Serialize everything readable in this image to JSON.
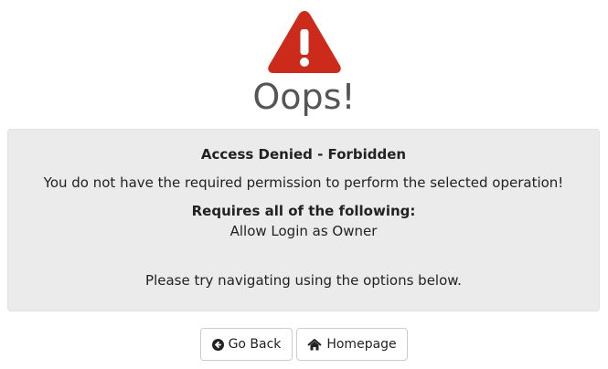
{
  "header": {
    "title": "Oops!",
    "icon": "warning-triangle-icon",
    "accent_color": "#cc2a1a"
  },
  "message": {
    "heading": "Access Denied - Forbidden",
    "body": "You do not have the required permission to perform the selected operation!",
    "requirements_heading": "Requires all of the following:",
    "requirement": "Allow Login as Owner",
    "hint": "Please try navigating using the options below."
  },
  "actions": {
    "back_label": "Go Back",
    "back_icon": "arrow-circle-left-icon",
    "home_label": "Homepage",
    "home_icon": "home-icon"
  }
}
